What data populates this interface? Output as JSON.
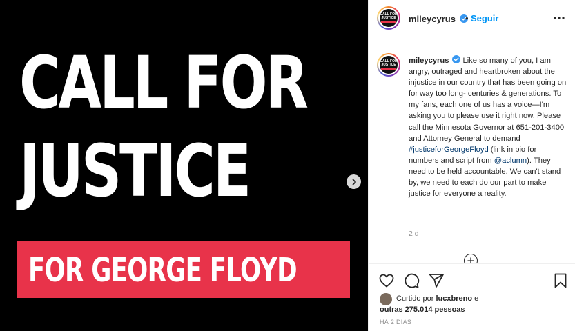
{
  "media": {
    "line1": "CALL FOR",
    "line2": "JUSTICE",
    "banner": "FOR GEORGE FLOYD",
    "banner_color": "#e8334a",
    "next_icon": "chevron-right-icon"
  },
  "header": {
    "username": "mileycyrus",
    "separator": "•",
    "follow_label": "Seguir",
    "verified_icon": "verified-badge-icon",
    "more_icon": "more-options-icon"
  },
  "avatar": {
    "line1": "CALL FOR",
    "line2": "JUSTICE"
  },
  "caption": {
    "username": "mileycyrus",
    "text1": "Like so many of you, I am angry, outraged and heartbroken about the injustice in our country that has been going on for way too long- centuries & generations. To my fans, each one of us has a voice—I'm asking you to please use it right now. Please call the Minnesota Governor at 651-201-3400 and Attorney General to demand ",
    "hashtag": "#justiceforGeorgeFloyd",
    "text2": " (link in bio for numbers and script from ",
    "mention": "@aclumn",
    "text3": "). They need to be held accountable. We can't stand by, we need to each do our part to make justice for everyone a reality.",
    "time": "2 d",
    "load_more_icon": "plus-circle-icon"
  },
  "actions": {
    "like_icon": "heart-icon",
    "comment_icon": "comment-icon",
    "share_icon": "share-icon",
    "save_icon": "bookmark-icon",
    "liked_prefix": "Curtido por ",
    "liked_user": "lucxbreno",
    "liked_mid": " e",
    "liked_others": "outras 275.014 pessoas",
    "ago": "HÁ 2 DIAS"
  },
  "colors": {
    "link": "#0095f6",
    "verified": "#3897f0"
  }
}
